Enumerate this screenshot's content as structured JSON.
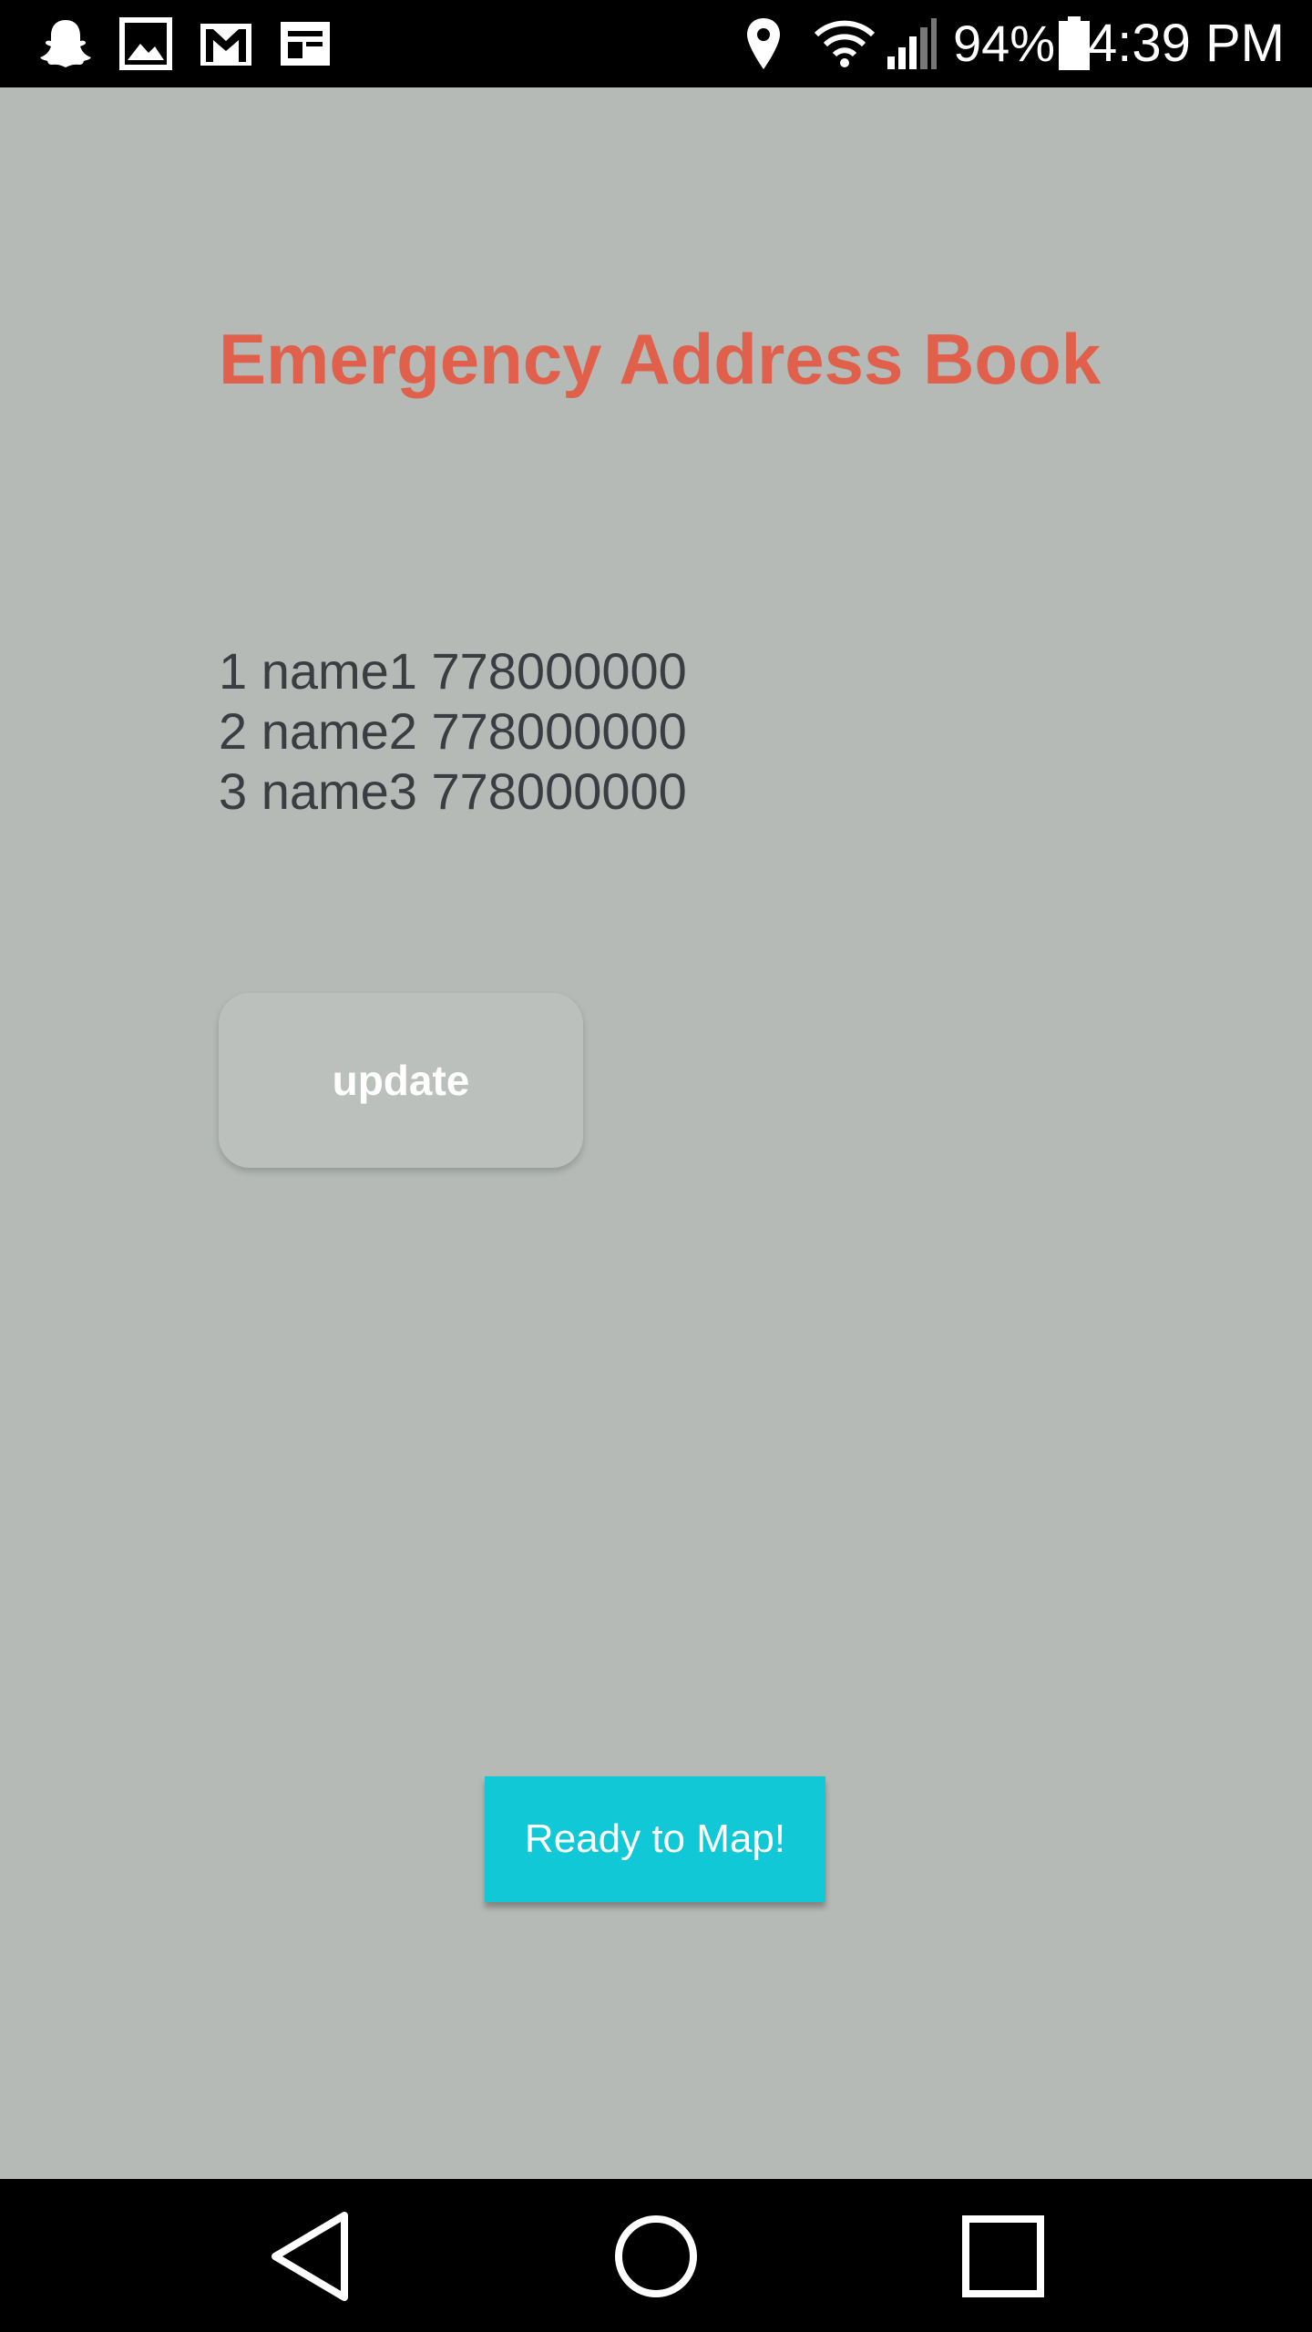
{
  "status_bar": {
    "notification_icons": [
      "snapchat-icon",
      "image-icon",
      "gmail-icon",
      "news-icon"
    ],
    "system_icons": [
      "location-icon",
      "wifi-icon",
      "signal-icon",
      "battery-icon"
    ],
    "battery_percent": "94%",
    "battery_level": 0.94,
    "time": "4:39 PM"
  },
  "main": {
    "title": "Emergency Address Book",
    "contacts": [
      "1 name1 778000000",
      "2 name2 778000000",
      "3 name3 778000000"
    ],
    "update_label": "update",
    "ready_label": "Ready to Map!"
  },
  "nav_bar": {
    "buttons": [
      "back-icon",
      "home-icon",
      "recents-icon"
    ]
  },
  "colors": {
    "background": "#b5bab7",
    "title": "#e0604b",
    "contact_text": "#3a3e42",
    "update_button": "#bcc0bd",
    "ready_button": "#10c8d6",
    "bars": "#000000"
  }
}
